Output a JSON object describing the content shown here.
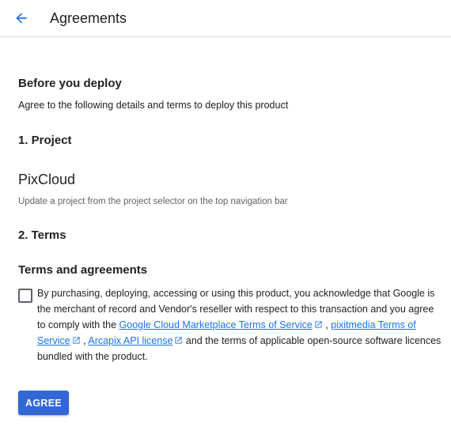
{
  "header": {
    "title": "Agreements",
    "back_icon": "arrow-back-icon"
  },
  "before_deploy": {
    "heading": "Before you deploy",
    "description": "Agree to the following details and terms to deploy this product"
  },
  "project": {
    "heading": "1. Project",
    "name": "PixCloud",
    "hint": "Update a project from the project selector on the top navigation bar"
  },
  "terms": {
    "heading": "2. Terms",
    "subheading": "Terms and agreements",
    "checked": false,
    "text_1": "By purchasing, deploying, accessing or using this product, you acknowledge that Google is the merchant of record and Vendor's reseller with respect to this transaction and you agree to comply with the ",
    "link_1": "Google Cloud Marketplace Terms of Service",
    "sep_1": " , ",
    "link_2": "pixitmedia Terms of Service",
    "sep_2": " , ",
    "link_3": "Arcapix API license",
    "text_2": " and the terms of applicable open-source software licences bundled with the product.",
    "external_icon": "open-in-new-icon"
  },
  "actions": {
    "agree_label": "AGREE"
  },
  "colors": {
    "accent": "#3367d6",
    "link": "#1a73e8",
    "back_arrow": "#1a73e8"
  }
}
